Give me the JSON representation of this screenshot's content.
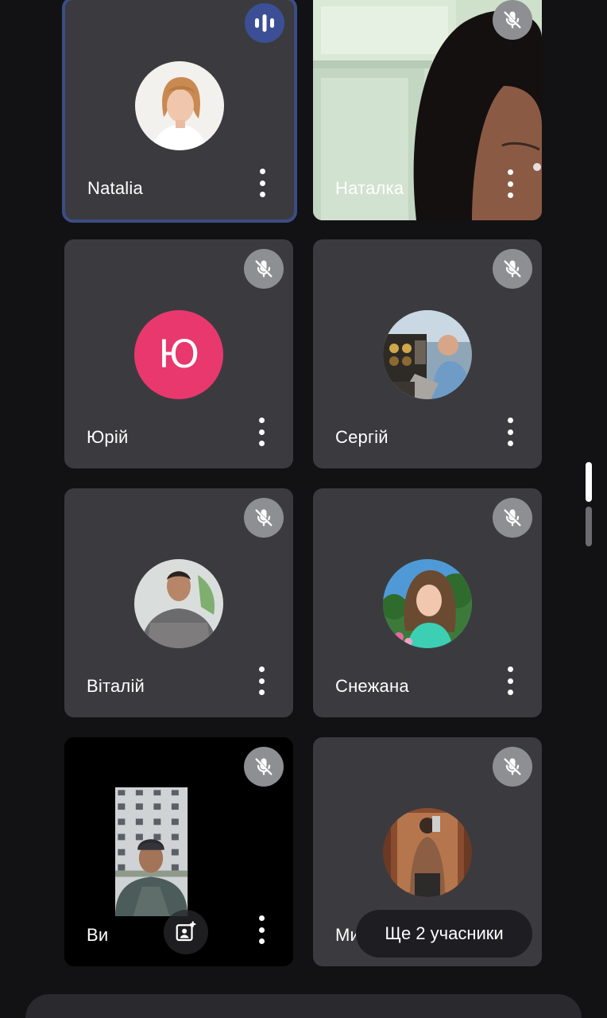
{
  "participants": [
    {
      "name": "Natalia",
      "state": "speaking",
      "media": "avatar-photo"
    },
    {
      "name": "Наталка",
      "state": "muted",
      "media": "camera"
    },
    {
      "name": "Юрій",
      "state": "muted",
      "media": "initial",
      "initial": "Ю"
    },
    {
      "name": "Сергій",
      "state": "muted",
      "media": "avatar-photo"
    },
    {
      "name": "Віталій",
      "state": "muted",
      "media": "avatar-photo"
    },
    {
      "name": "Снежана",
      "state": "muted",
      "media": "avatar-photo"
    },
    {
      "name": "Ви",
      "state": "muted",
      "media": "camera"
    },
    {
      "name": "Михайло",
      "state": "muted",
      "media": "avatar-photo"
    }
  ],
  "more_participants_label": "Ще 2 учасники",
  "icons": {
    "mic_off": "mic-off-icon",
    "speaking": "audio-level-icon",
    "more": "more-vert-icon",
    "switch_camera": "switch-camera-icon"
  },
  "colors": {
    "background": "#121214",
    "tile": "#3b3b3f",
    "active_border": "#3c4d86",
    "initial_avatar": "#e8386e",
    "mute_badge": "#8e8f92"
  }
}
